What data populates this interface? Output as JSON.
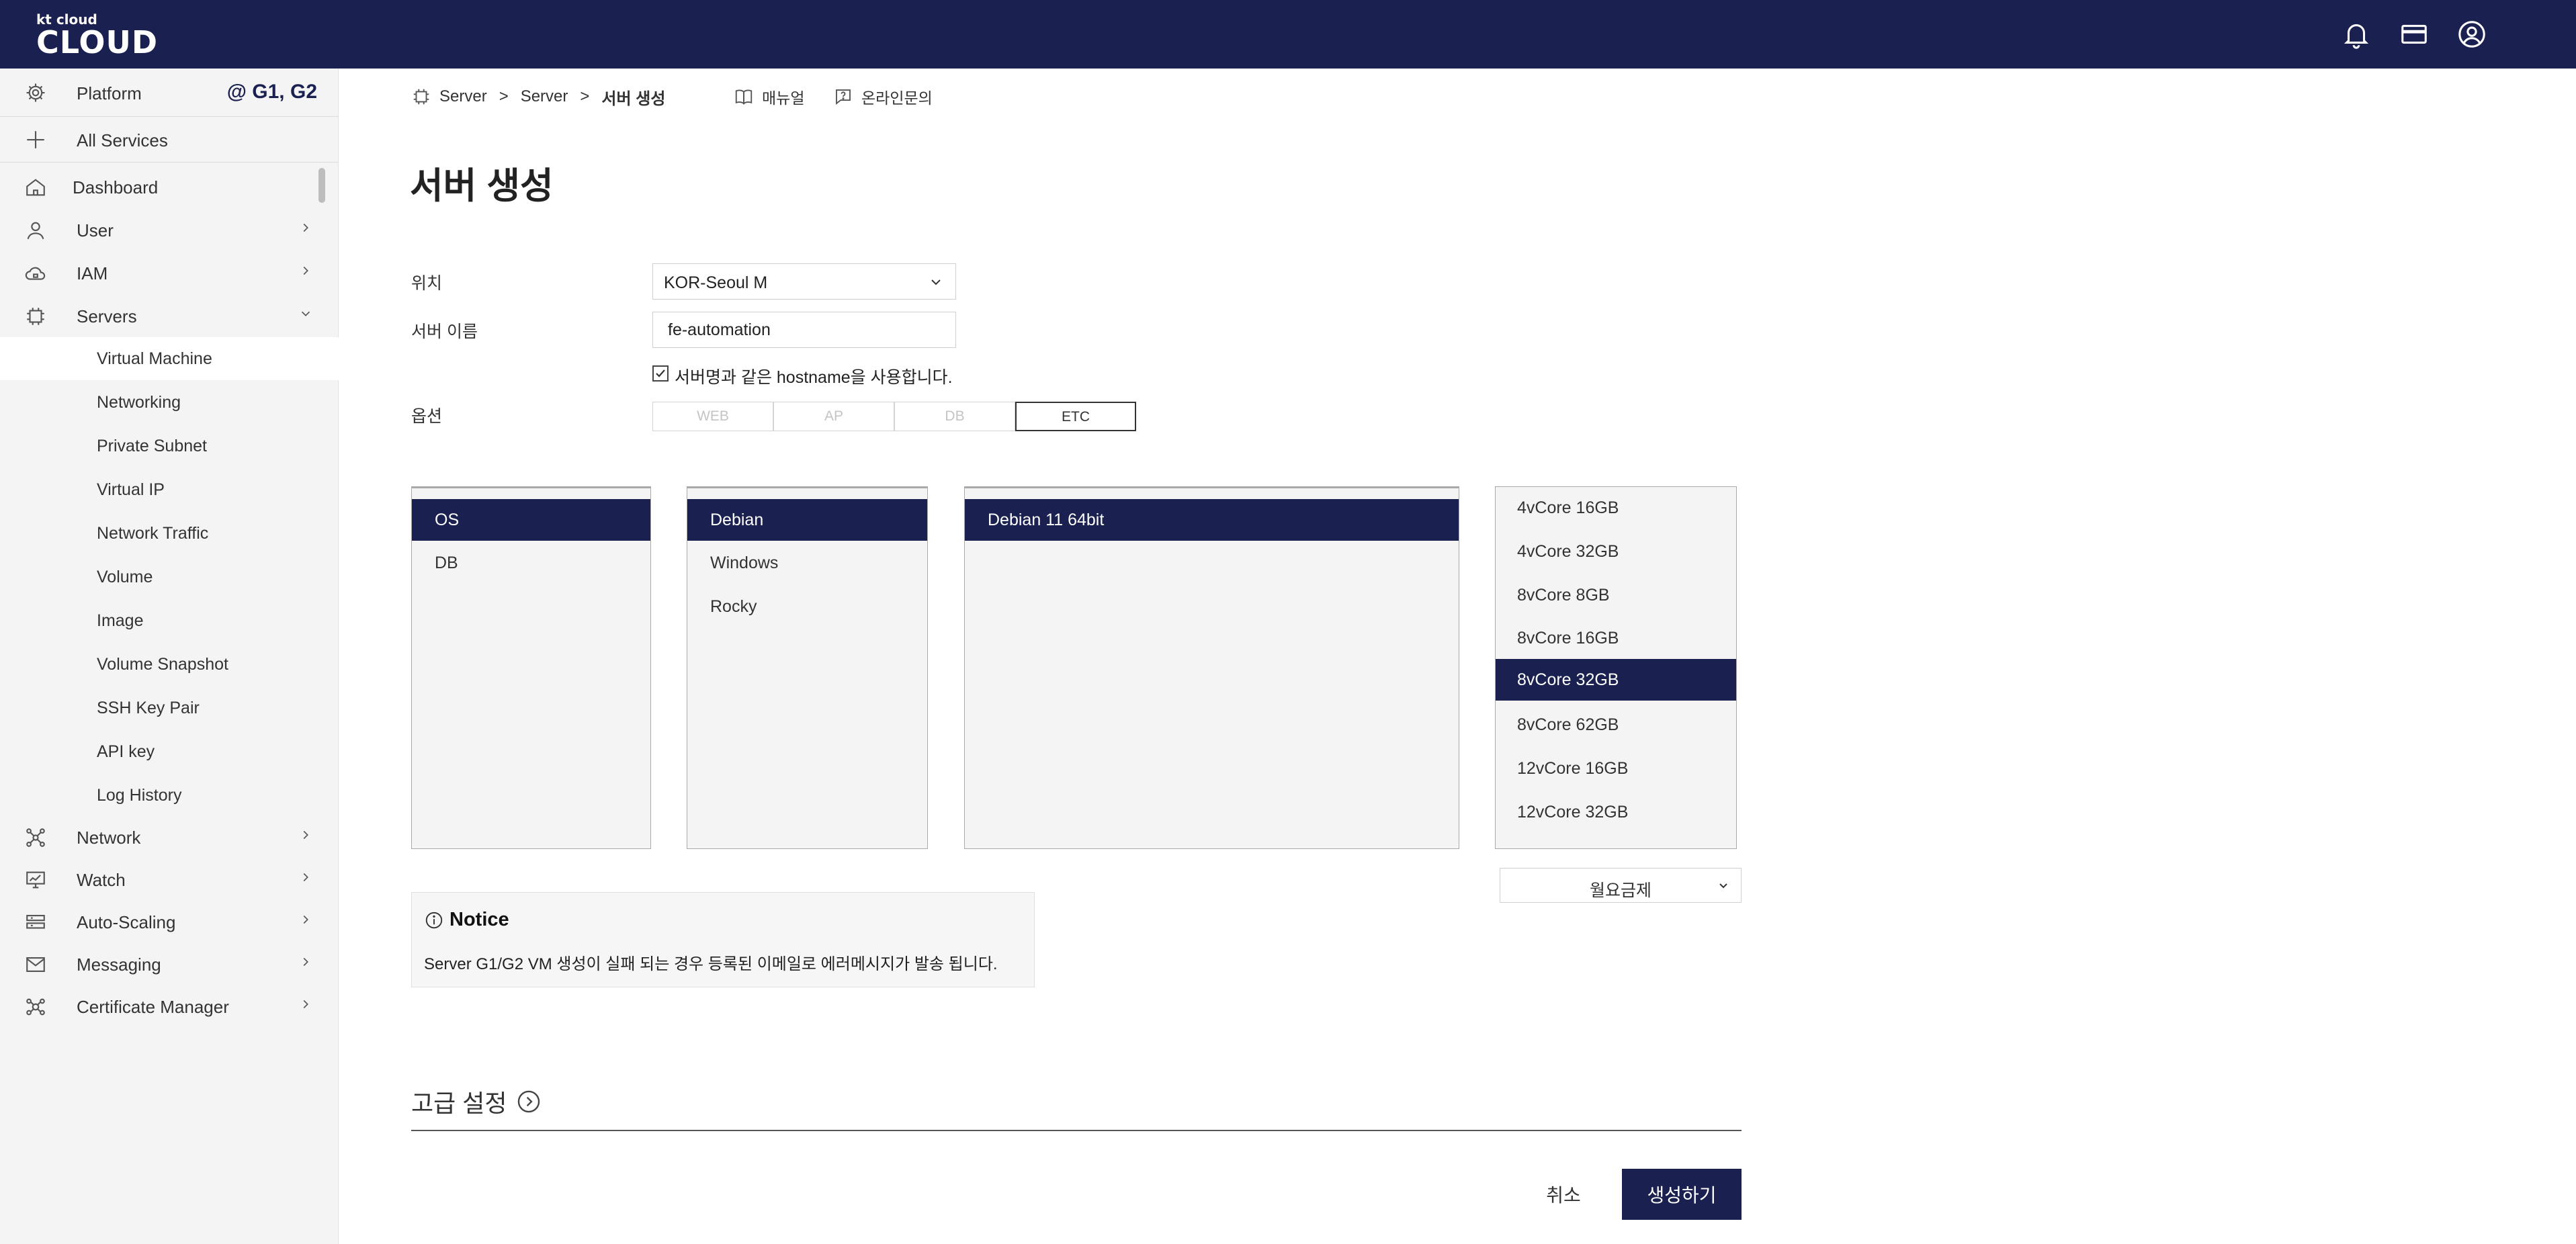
{
  "header": {
    "logo_small": "kt cloud",
    "logo_big": "CLOUD",
    "icons": [
      "bell-icon",
      "card-icon",
      "user-circle-icon"
    ]
  },
  "sidebar": {
    "platform_label": "Platform",
    "platform_tag": "@ G1, G2",
    "all_services": "All Services",
    "items": [
      {
        "label": "Dashboard",
        "icon": "home-icon"
      },
      {
        "label": "User",
        "icon": "user-icon"
      },
      {
        "label": "IAM",
        "icon": "cloud-lock-icon"
      },
      {
        "label": "Servers",
        "icon": "chip-icon"
      }
    ],
    "sub_items": [
      "Virtual Machine",
      "Networking",
      "Private Subnet",
      "Virtual IP",
      "Network Traffic",
      "Volume",
      "Image",
      "Volume Snapshot",
      "SSH Key Pair",
      "API key",
      "Log History"
    ],
    "bottom_items": [
      {
        "label": "Network",
        "icon": "network-icon"
      },
      {
        "label": "Watch",
        "icon": "monitor-chart-icon"
      },
      {
        "label": "Auto-Scaling",
        "icon": "server-stack-icon"
      },
      {
        "label": "Messaging",
        "icon": "mail-icon"
      },
      {
        "label": "Certificate Manager",
        "icon": "cert-icon"
      }
    ]
  },
  "breadcrumb": {
    "items": [
      "Server",
      "Server",
      "서버 생성"
    ],
    "manual": "매뉴얼",
    "inquiry": "온라인문의"
  },
  "page": {
    "title": "서버 생성",
    "location_label": "위치",
    "location_value": "KOR-Seoul M",
    "name_label": "서버 이름",
    "name_value": "fe-automation",
    "hostname_check": "서버명과 같은 hostname을 사용합니다.",
    "option_label": "옵션",
    "options": [
      "WEB",
      "AP",
      "DB",
      "ETC"
    ],
    "selected_option": "ETC"
  },
  "lists": {
    "category": {
      "items": [
        "OS",
        "DB"
      ],
      "selected": "OS"
    },
    "os": {
      "items": [
        "Debian",
        "Windows",
        "Rocky"
      ],
      "selected": "Debian"
    },
    "version": {
      "items": [
        "Debian 11 64bit"
      ],
      "selected": "Debian 11 64bit"
    },
    "spec": {
      "items": [
        "4vCore 16GB",
        "4vCore 32GB",
        "8vCore 8GB",
        "8vCore 16GB",
        "8vCore 32GB",
        "8vCore 62GB",
        "12vCore 16GB",
        "12vCore 32GB"
      ],
      "selected": "8vCore 32GB"
    }
  },
  "billing": {
    "value": "월요금제"
  },
  "notice": {
    "title": "Notice",
    "body": "Server G1/G2 VM 생성이 실패 되는 경우 등록된 이메일로 에러메시지가 발송 됩니다."
  },
  "advanced": {
    "label": "고급 설정"
  },
  "actions": {
    "cancel": "취소",
    "create": "생성하기"
  }
}
